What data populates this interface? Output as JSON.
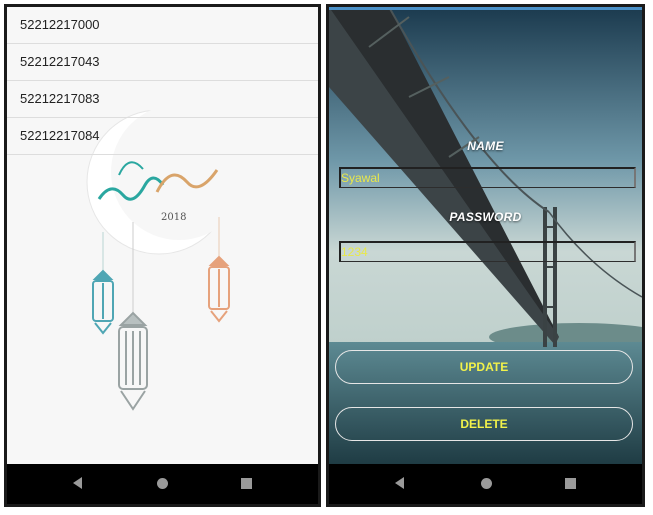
{
  "left_screen": {
    "list_items": [
      "52212217000",
      "52212217043",
      "52212217083",
      "52212217084"
    ],
    "decoration": {
      "year_text": "2018"
    }
  },
  "right_screen": {
    "name_label": "NAME",
    "name_value": "Syawal",
    "password_label": "PASSWORD",
    "password_value": "1234",
    "update_label": "UPDATE",
    "delete_label": "DELETE"
  },
  "colors": {
    "accent_text": "#e8e84a",
    "status_strip": "#4a90c8"
  },
  "nav": {
    "icons": [
      "back-icon",
      "home-icon",
      "recents-icon"
    ]
  }
}
